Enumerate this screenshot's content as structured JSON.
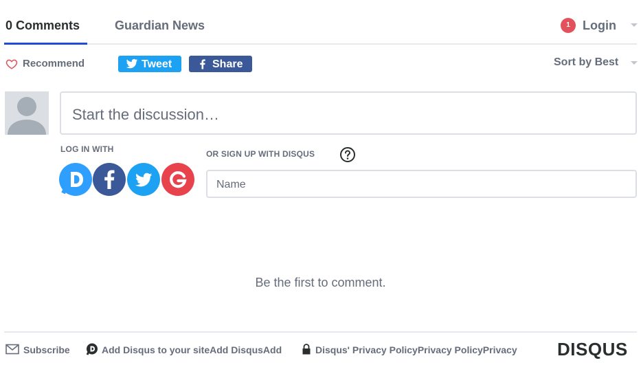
{
  "nav": {
    "tabs": [
      {
        "label": "0 Comments",
        "active": true
      },
      {
        "label": "Guardian News",
        "active": false
      }
    ],
    "login": {
      "badge_count": "1",
      "label": "Login"
    }
  },
  "actions": {
    "recommend_label": "Recommend",
    "tweet_label": "Tweet",
    "share_label": "Share",
    "sort_label": "Sort by Best"
  },
  "composer": {
    "placeholder": "Start the discussion…",
    "login_with_label": "LOG IN WITH",
    "social_providers": [
      "disqus-icon",
      "facebook-icon",
      "twitter-icon",
      "google-icon"
    ],
    "signup_label": "OR SIGN UP WITH DISQUS",
    "name_placeholder": "Name"
  },
  "empty_message": "Be the first to comment.",
  "footer": {
    "subscribe_label": "Subscribe",
    "add_disqus_label": "Add Disqus to your siteAdd DisqusAdd",
    "privacy_label": "Disqus' Privacy PolicyPrivacy PolicyPrivacy",
    "logo_text": "DISQUS"
  },
  "colors": {
    "accent": "#1f4bd6",
    "badge": "#e2525c",
    "twitter": "#1da1f2",
    "facebook": "#3b5998",
    "google": "#e8424c",
    "disqus": "#2e9fff",
    "muted_text": "#656c7a",
    "border": "#dbdfe4"
  }
}
